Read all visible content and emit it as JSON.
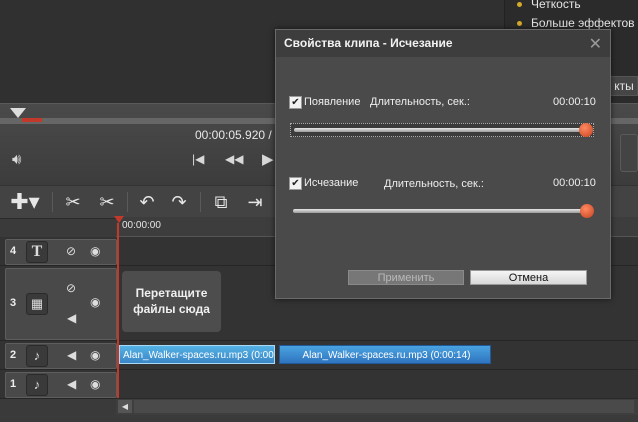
{
  "side_panel": {
    "items": [
      "Четкость",
      "Больше эффектов"
    ],
    "tab_partial": "кты"
  },
  "player": {
    "time": "00:00:05.920  /",
    "volume_icon": "speaker-icon",
    "controls": [
      "skip-back-icon",
      "rewind-icon",
      "play-icon"
    ]
  },
  "toolbar": {
    "icons": [
      "add-icon",
      "cut-icon",
      "cut-all-icon",
      "rotate-left-icon",
      "rotate-right-icon",
      "clip-properties-icon",
      "clip-export-icon"
    ]
  },
  "ruler": {
    "start_time": "00:00:00"
  },
  "tracks": [
    {
      "num": "4",
      "type": "text"
    },
    {
      "num": "3",
      "type": "video"
    },
    {
      "num": "2",
      "type": "audio"
    },
    {
      "num": "1",
      "type": "audio"
    }
  ],
  "drop_hint": "Перетащите файлы сюда",
  "clips": [
    {
      "label": "Alan_Walker-spaces.ru.mp3 (0:00:"
    },
    {
      "label": "Alan_Walker-spaces.ru.mp3 (0:00:14)"
    }
  ],
  "dialog": {
    "title": "Свойства клипа - Исчезание",
    "fade_in": {
      "label": "Появление",
      "duration_label": "Длительность, сек.:",
      "value": "00:00:10",
      "checked": true
    },
    "fade_out": {
      "label": "Исчезание",
      "duration_label": "Длительность, сек.:",
      "value": "00:00:10",
      "checked": true
    },
    "apply_label": "Применить",
    "cancel_label": "Отмена"
  },
  "colors": {
    "clip_blue": "#2f74c0",
    "playhead": "#c0392b",
    "slider_knob": "#e0542b"
  }
}
